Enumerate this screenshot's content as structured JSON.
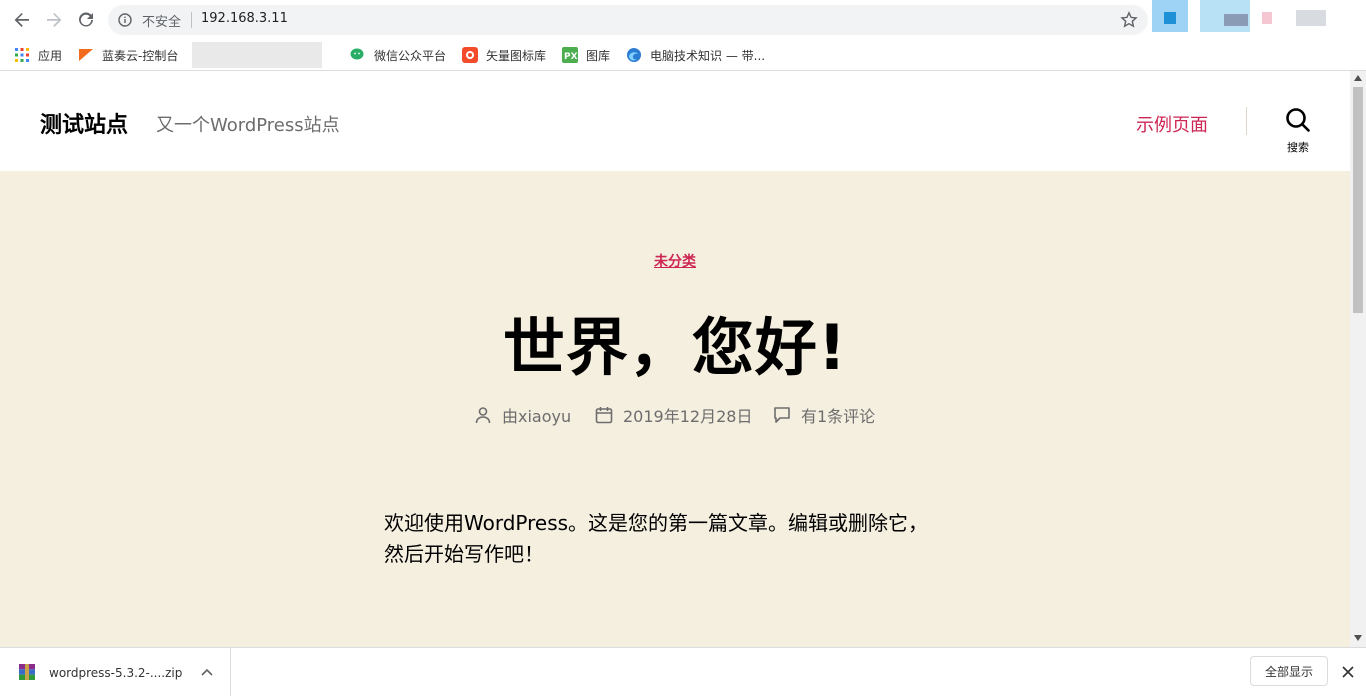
{
  "browser": {
    "security_label": "不安全",
    "url": "192.168.3.11",
    "bookmarks": [
      {
        "label": "应用",
        "icon": "apps-grid-icon"
      },
      {
        "label": "蓝奏云-控制台",
        "icon": "lanzou-icon"
      },
      {
        "label": "微信公众平台",
        "icon": "wechat-icon"
      },
      {
        "label": "矢量图标库",
        "icon": "iconfont-icon"
      },
      {
        "label": "图库",
        "icon": "px-icon"
      },
      {
        "label": "电脑技术知识 — 带...",
        "icon": "edge-globe-icon"
      }
    ]
  },
  "site": {
    "title": "测试站点",
    "description": "又一个WordPress站点",
    "menu_item": "示例页面",
    "search_label": "搜索"
  },
  "post": {
    "category": "未分类",
    "title": "世界，您好!",
    "author": "由xiaoyu",
    "date": "2019年12月28日",
    "comments": "有1条评论",
    "content_line1": "欢迎使用WordPress。这是您的第一篇文章。编辑或删除它，",
    "content_line2": "然后开始写作吧！"
  },
  "download_bar": {
    "file_name": "wordpress-5.3.2-....zip",
    "show_all": "全部显示"
  },
  "colors": {
    "accent": "#cd2653",
    "page_bg": "#f5efe0"
  }
}
